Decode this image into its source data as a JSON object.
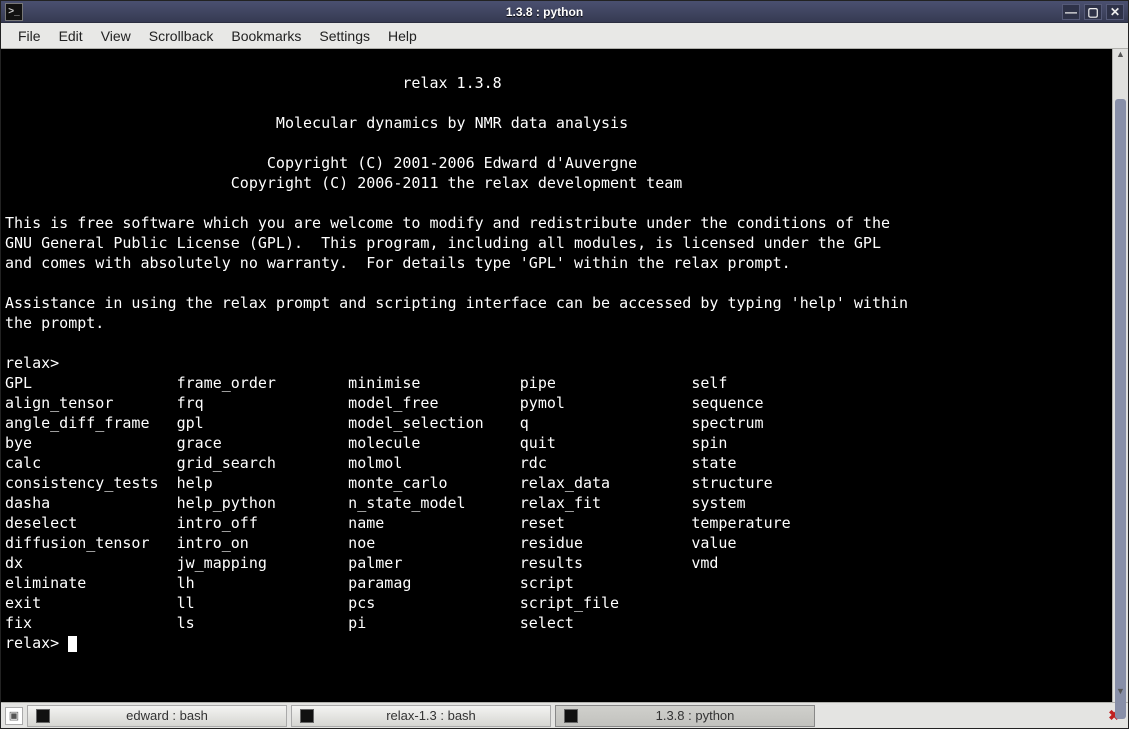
{
  "window": {
    "title": "1.3.8 : python"
  },
  "menubar": [
    "File",
    "Edit",
    "View",
    "Scrollback",
    "Bookmarks",
    "Settings",
    "Help"
  ],
  "terminal": {
    "banner_title": "relax 1.3.8",
    "banner_sub": "Molecular dynamics by NMR data analysis",
    "copyright1": "Copyright (C) 2001-2006 Edward d'Auvergne",
    "copyright2": "Copyright (C) 2006-2011 the relax development team",
    "para1": "This is free software which you are welcome to modify and redistribute under the conditions of the\nGNU General Public License (GPL).  This program, including all modules, is licensed under the GPL\nand comes with absolutely no warranty.  For details type 'GPL' within the relax prompt.",
    "para2": "Assistance in using the relax prompt and scripting interface can be accessed by typing 'help' within\nthe prompt.",
    "prompt": "relax>",
    "columns": [
      [
        "GPL",
        "align_tensor",
        "angle_diff_frame",
        "bye",
        "calc",
        "consistency_tests",
        "dasha",
        "deselect",
        "diffusion_tensor",
        "dx",
        "eliminate",
        "exit",
        "fix"
      ],
      [
        "frame_order",
        "frq",
        "gpl",
        "grace",
        "grid_search",
        "help",
        "help_python",
        "intro_off",
        "intro_on",
        "jw_mapping",
        "lh",
        "ll",
        "ls"
      ],
      [
        "minimise",
        "model_free",
        "model_selection",
        "molecule",
        "molmol",
        "monte_carlo",
        "n_state_model",
        "name",
        "noe",
        "palmer",
        "paramag",
        "pcs",
        "pi"
      ],
      [
        "pipe",
        "pymol",
        "q",
        "quit",
        "rdc",
        "relax_data",
        "relax_fit",
        "reset",
        "residue",
        "results",
        "script",
        "script_file",
        "select"
      ],
      [
        "self",
        "sequence",
        "spectrum",
        "spin",
        "state",
        "structure",
        "system",
        "temperature",
        "value",
        "vmd",
        "",
        "",
        ""
      ]
    ]
  },
  "taskbar": {
    "tasks": [
      {
        "label": "edward : bash",
        "active": false
      },
      {
        "label": "relax-1.3 : bash",
        "active": false
      },
      {
        "label": "1.3.8 : python",
        "active": true
      }
    ]
  }
}
